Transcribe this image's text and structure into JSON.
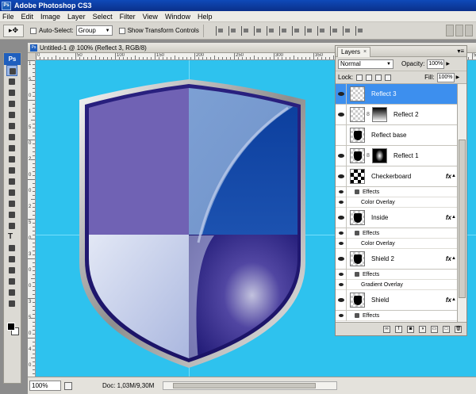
{
  "window": {
    "title": "Adobe Photoshop CS3",
    "app_badge": "Ps"
  },
  "menu": [
    "File",
    "Edit",
    "Image",
    "Layer",
    "Select",
    "Filter",
    "View",
    "Window",
    "Help"
  ],
  "options": {
    "auto_select_label": "Auto-Select:",
    "auto_select_value": "Group",
    "transform_label": "Show Transform Controls"
  },
  "document": {
    "title": "Untitled-1 @ 100% (Reflect 3, RGB/8)",
    "ruler_top": [
      "0",
      "50",
      "100",
      "150",
      "200",
      "250",
      "300",
      "350",
      "400",
      "450",
      "500",
      "550"
    ],
    "ruler_left": [
      "1",
      "5",
      "0",
      "1",
      "5",
      "0",
      "2",
      "0",
      "0",
      "2",
      "5",
      "0",
      "3",
      "0",
      "0",
      "3",
      "5",
      "0",
      "4",
      "0"
    ],
    "zoom": "100%",
    "doc_size": "Doc: 1,03M/9,30M"
  },
  "layers_panel": {
    "tab_label": "Layers",
    "blend_mode": "Normal",
    "opacity_label": "Opacity:",
    "opacity_value": "100%",
    "lock_label": "Lock:",
    "fill_label": "Fill:",
    "fill_value": "100%",
    "layers": [
      {
        "name": "Reflect 3",
        "selected": true,
        "visible": true,
        "thumb": "transparent",
        "mask": null,
        "fx": false,
        "effects": []
      },
      {
        "name": "Reflect 2",
        "selected": false,
        "visible": true,
        "thumb": "transparent",
        "mask": "gradient",
        "fx": false,
        "effects": []
      },
      {
        "name": "Reflect base",
        "selected": false,
        "visible": false,
        "thumb": "shield",
        "mask": null,
        "fx": false,
        "effects": []
      },
      {
        "name": "Reflect 1",
        "selected": false,
        "visible": true,
        "thumb": "shield",
        "mask": "blur",
        "fx": false,
        "effects": []
      },
      {
        "name": "Checkerboard",
        "selected": false,
        "visible": true,
        "thumb": "checker",
        "mask": null,
        "fx": true,
        "effects": [
          "Color Overlay"
        ]
      },
      {
        "name": "Inside",
        "selected": false,
        "visible": true,
        "thumb": "shield",
        "mask": null,
        "fx": true,
        "effects": [
          "Color Overlay"
        ]
      },
      {
        "name": "Shield 2",
        "selected": false,
        "visible": true,
        "thumb": "shield",
        "mask": null,
        "fx": true,
        "effects": [
          "Gradient Overlay"
        ]
      },
      {
        "name": "Shield",
        "selected": false,
        "visible": true,
        "thumb": "shield",
        "mask": null,
        "fx": true,
        "effects": []
      }
    ],
    "effects_label": "Effects",
    "fx_label": "fx"
  },
  "colors": {
    "canvas": "#2ec2ee",
    "selection": "#3d8fee",
    "title_bar": "#0a2f8a"
  }
}
